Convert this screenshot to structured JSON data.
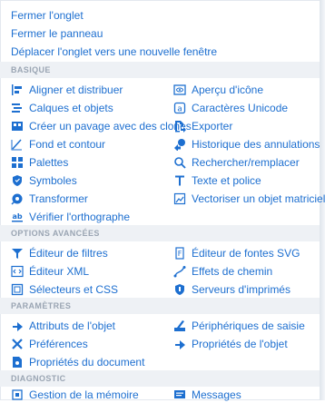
{
  "menu": {
    "top_items": [
      "Fermer l'onglet",
      "Fermer le panneau",
      "Déplacer l'onglet vers une nouvelle fenêtre"
    ],
    "sections": [
      {
        "title": "BASIQUE",
        "items": [
          {
            "label": "Aligner et distribuer",
            "icon": "align-distribute-icon"
          },
          {
            "label": "Aperçu d'icône",
            "icon": "icon-preview-icon"
          },
          {
            "label": "Calques et objets",
            "icon": "layers-objects-icon"
          },
          {
            "label": "Caractères Unicode",
            "icon": "unicode-characters-icon"
          },
          {
            "label": "Créer un pavage avec des clones",
            "icon": "tile-clones-icon"
          },
          {
            "label": "Exporter",
            "icon": "export-icon"
          },
          {
            "label": "Fond et contour",
            "icon": "fill-stroke-icon"
          },
          {
            "label": "Historique des annulations",
            "icon": "undo-history-icon"
          },
          {
            "label": "Palettes",
            "icon": "palettes-icon"
          },
          {
            "label": "Rechercher/remplacer",
            "icon": "find-replace-icon"
          },
          {
            "label": "Symboles",
            "icon": "symbols-icon"
          },
          {
            "label": "Texte et police",
            "icon": "text-font-icon"
          },
          {
            "label": "Transformer",
            "icon": "transform-icon"
          },
          {
            "label": "Vectoriser un objet matriciel",
            "icon": "trace-bitmap-icon"
          },
          {
            "label": "Vérifier l'orthographe",
            "icon": "spellcheck-icon"
          }
        ]
      },
      {
        "title": "OPTIONS AVANCÉES",
        "items": [
          {
            "label": "Éditeur de filtres",
            "icon": "filter-editor-icon"
          },
          {
            "label": "Éditeur de fontes SVG",
            "icon": "svg-font-editor-icon"
          },
          {
            "label": "Éditeur XML",
            "icon": "xml-editor-icon"
          },
          {
            "label": "Effets de chemin",
            "icon": "path-effects-icon"
          },
          {
            "label": "Sélecteurs et CSS",
            "icon": "selectors-css-icon"
          },
          {
            "label": "Serveurs d'imprimés",
            "icon": "swatch-servers-icon"
          }
        ]
      },
      {
        "title": "PARAMÈTRES",
        "items": [
          {
            "label": "Attributs de l'objet",
            "icon": "object-attributes-icon"
          },
          {
            "label": "Périphériques de saisie",
            "icon": "input-devices-icon"
          },
          {
            "label": "Préférences",
            "icon": "preferences-icon"
          },
          {
            "label": "Propriétés de l'objet",
            "icon": "object-properties-icon"
          },
          {
            "label": "Propriétés du document",
            "icon": "document-properties-icon"
          }
        ]
      },
      {
        "title": "DIAGNOSTIC",
        "items": [
          {
            "label": "Gestion de la mémoire",
            "icon": "memory-icon"
          },
          {
            "label": "Messages",
            "icon": "messages-icon"
          }
        ]
      }
    ]
  },
  "colors": {
    "accent": "#1d6fd0",
    "section_bg": "#eef1f5",
    "section_text": "#9aa5b3"
  }
}
